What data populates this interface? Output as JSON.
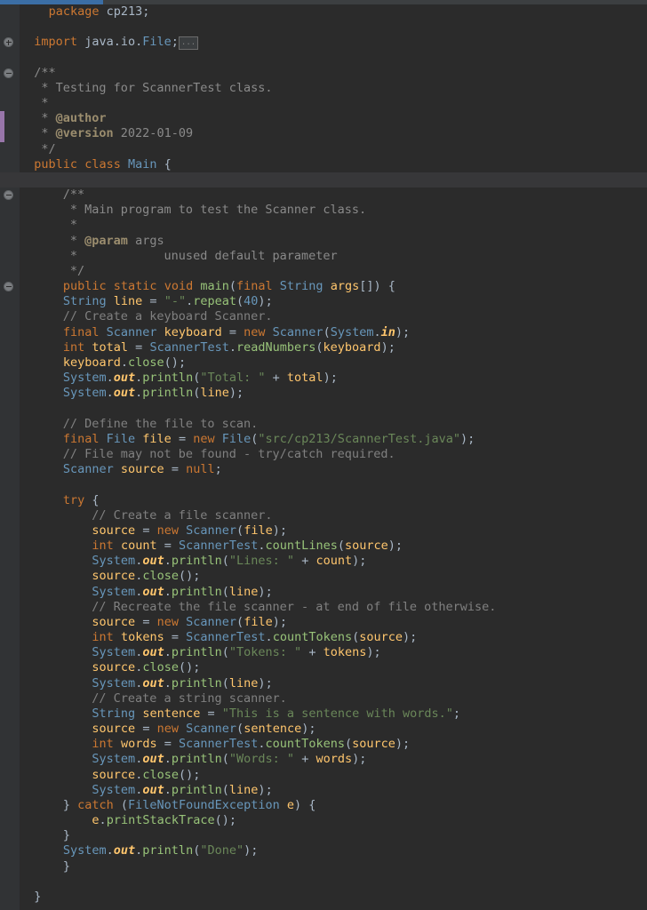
{
  "window": {
    "kind": "code-editor",
    "language": "Java",
    "theme": "Darcula"
  },
  "top_bar": {
    "name": "progress-bar",
    "fill_percent": 16,
    "fill_color": "#3b6ea5",
    "track_color": "#3c3f41"
  },
  "gutter": {
    "change_marker_color": "#9876aa",
    "fold_collapsed_label": "+",
    "fold_expanded_label": "-"
  },
  "editor": {
    "background": "#2b2b2b",
    "gutter_background": "#313335",
    "caret_line_background": "#373739",
    "caret_line_index": 11,
    "fold_chip_text": "...",
    "colors": {
      "keyword": "#cc7832",
      "type": "#6897bb",
      "variable": "#ffc66d",
      "string": "#6a8759",
      "comment": "#808080",
      "method": "#98c379",
      "javadoc_tag": "#9b8d6e",
      "default": "#a9b7c6",
      "annotation": "#bbb529"
    }
  },
  "code": {
    "lines": [
      {
        "text": "    package cp213;",
        "fold": null,
        "marker": false
      },
      {
        "text": "",
        "fold": null,
        "marker": false
      },
      {
        "text": "  import java.io.File;",
        "fold": "plus",
        "marker": false
      },
      {
        "text": "",
        "fold": null,
        "marker": false
      },
      {
        "text": "  /**",
        "fold": "minus",
        "marker": false
      },
      {
        "text": "   * Testing for ScannerTest class.",
        "fold": null,
        "marker": false
      },
      {
        "text": "   *",
        "fold": null,
        "marker": false
      },
      {
        "text": "   * @author",
        "fold": null,
        "marker": true
      },
      {
        "text": "   * @version 2022-01-09",
        "fold": null,
        "marker": true
      },
      {
        "text": "   */",
        "fold": null,
        "marker": false
      },
      {
        "text": "  public class Main {",
        "fold": null,
        "marker": false
      },
      {
        "text": "",
        "fold": null,
        "marker": false
      },
      {
        "text": "      /**",
        "fold": "minus",
        "marker": false
      },
      {
        "text": "       * Main program to test the Scanner class.",
        "fold": null,
        "marker": false
      },
      {
        "text": "       *",
        "fold": null,
        "marker": false
      },
      {
        "text": "       * @param args",
        "fold": null,
        "marker": false
      },
      {
        "text": "       *            unused default parameter",
        "fold": null,
        "marker": false
      },
      {
        "text": "       */",
        "fold": null,
        "marker": false
      },
      {
        "text": "      public static void main(final String args[]) {",
        "fold": "minus",
        "marker": false
      },
      {
        "text": "      String line = \"-\".repeat(40);",
        "fold": null,
        "marker": false
      },
      {
        "text": "      // Create a keyboard Scanner.",
        "fold": null,
        "marker": false
      },
      {
        "text": "      final Scanner keyboard = new Scanner(System.in);",
        "fold": null,
        "marker": false
      },
      {
        "text": "      int total = ScannerTest.readNumbers(keyboard);",
        "fold": null,
        "marker": false
      },
      {
        "text": "      keyboard.close();",
        "fold": null,
        "marker": false
      },
      {
        "text": "      System.out.println(\"Total: \" + total);",
        "fold": null,
        "marker": false
      },
      {
        "text": "      System.out.println(line);",
        "fold": null,
        "marker": false
      },
      {
        "text": "",
        "fold": null,
        "marker": false
      },
      {
        "text": "      // Define the file to scan.",
        "fold": null,
        "marker": false
      },
      {
        "text": "      final File file = new File(\"src/cp213/ScannerTest.java\");",
        "fold": null,
        "marker": false
      },
      {
        "text": "      // File may not be found - try/catch required.",
        "fold": null,
        "marker": false
      },
      {
        "text": "      Scanner source = null;",
        "fold": null,
        "marker": false
      },
      {
        "text": "",
        "fold": null,
        "marker": false
      },
      {
        "text": "      try {",
        "fold": null,
        "marker": false
      },
      {
        "text": "          // Create a file scanner.",
        "fold": null,
        "marker": false
      },
      {
        "text": "          source = new Scanner(file);",
        "fold": null,
        "marker": false
      },
      {
        "text": "          int count = ScannerTest.countLines(source);",
        "fold": null,
        "marker": false
      },
      {
        "text": "          System.out.println(\"Lines: \" + count);",
        "fold": null,
        "marker": false
      },
      {
        "text": "          source.close();",
        "fold": null,
        "marker": false
      },
      {
        "text": "          System.out.println(line);",
        "fold": null,
        "marker": false
      },
      {
        "text": "          // Recreate the file scanner - at end of file otherwise.",
        "fold": null,
        "marker": false
      },
      {
        "text": "          source = new Scanner(file);",
        "fold": null,
        "marker": false
      },
      {
        "text": "          int tokens = ScannerTest.countTokens(source);",
        "fold": null,
        "marker": false
      },
      {
        "text": "          System.out.println(\"Tokens: \" + tokens);",
        "fold": null,
        "marker": false
      },
      {
        "text": "          source.close();",
        "fold": null,
        "marker": false
      },
      {
        "text": "          System.out.println(line);",
        "fold": null,
        "marker": false
      },
      {
        "text": "          // Create a string scanner.",
        "fold": null,
        "marker": false
      },
      {
        "text": "          String sentence = \"This is a sentence with words.\";",
        "fold": null,
        "marker": false
      },
      {
        "text": "          source = new Scanner(sentence);",
        "fold": null,
        "marker": false
      },
      {
        "text": "          int words = ScannerTest.countTokens(source);",
        "fold": null,
        "marker": false
      },
      {
        "text": "          System.out.println(\"Words: \" + words);",
        "fold": null,
        "marker": false
      },
      {
        "text": "          source.close();",
        "fold": null,
        "marker": false
      },
      {
        "text": "          System.out.println(line);",
        "fold": null,
        "marker": false
      },
      {
        "text": "      } catch (FileNotFoundException e) {",
        "fold": null,
        "marker": false
      },
      {
        "text": "          e.printStackTrace();",
        "fold": null,
        "marker": false
      },
      {
        "text": "      }",
        "fold": null,
        "marker": false
      },
      {
        "text": "      System.out.println(\"Done\");",
        "fold": null,
        "marker": false
      },
      {
        "text": "      }",
        "fold": null,
        "marker": false
      },
      {
        "text": "",
        "fold": null,
        "marker": false
      },
      {
        "text": "  }",
        "fold": null,
        "marker": false
      }
    ]
  }
}
